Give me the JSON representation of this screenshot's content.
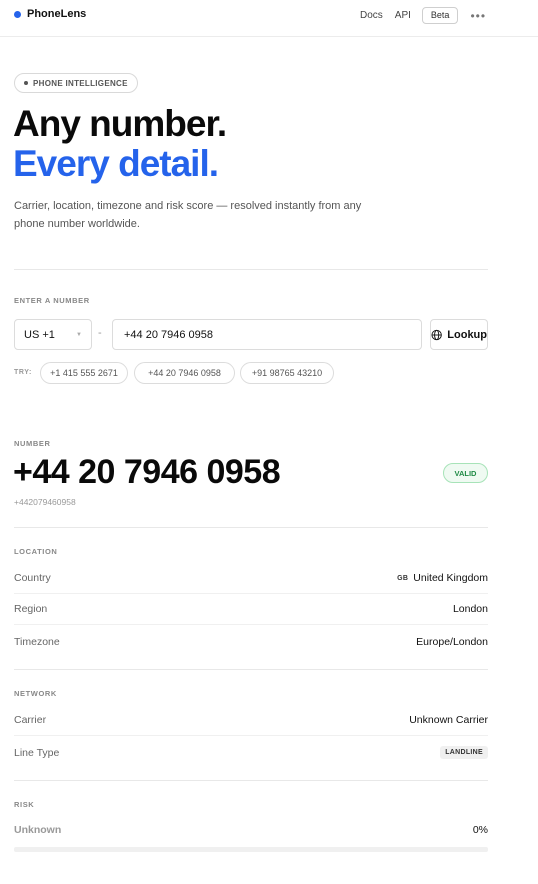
{
  "header": {
    "brand": "PhoneLens",
    "nav": {
      "docs": "Docs",
      "api": "API",
      "beta": "Beta",
      "more": "•••"
    }
  },
  "hero": {
    "pill": "PHONE INTELLIGENCE",
    "title_line1": "Any number.",
    "title_line2": "Every detail.",
    "description": "Carrier, location, timezone and risk score — resolved instantly from any phone number worldwide."
  },
  "form": {
    "label": "ENTER A NUMBER",
    "country_code": "US +1",
    "separator": "-",
    "phone_value": "+44 20 7946 0958",
    "lookup_label": "Lookup",
    "try_label": "TRY:",
    "examples": [
      "+1 415 555 2671",
      "+44 20 7946 0958",
      "+91 98765 43210"
    ]
  },
  "result": {
    "number_label": "NUMBER",
    "number_formatted": "+44 20 7946 0958",
    "number_raw": "+442079460958",
    "status": "VALID",
    "location": {
      "label": "LOCATION",
      "country_key": "Country",
      "country_flag": "GB",
      "country_value": "United Kingdom",
      "region_key": "Region",
      "region_value": "London",
      "timezone_key": "Timezone",
      "timezone_value": "Europe/London"
    },
    "network": {
      "label": "NETWORK",
      "carrier_key": "Carrier",
      "carrier_value": "Unknown Carrier",
      "line_type_key": "Line Type",
      "line_type_value": "LANDLINE"
    },
    "risk": {
      "label": "RISK",
      "level": "Unknown",
      "score_text": "0%",
      "score_fraction": 0
    }
  },
  "colors": {
    "accent": "#2563eb",
    "valid": "#1f8a45"
  }
}
